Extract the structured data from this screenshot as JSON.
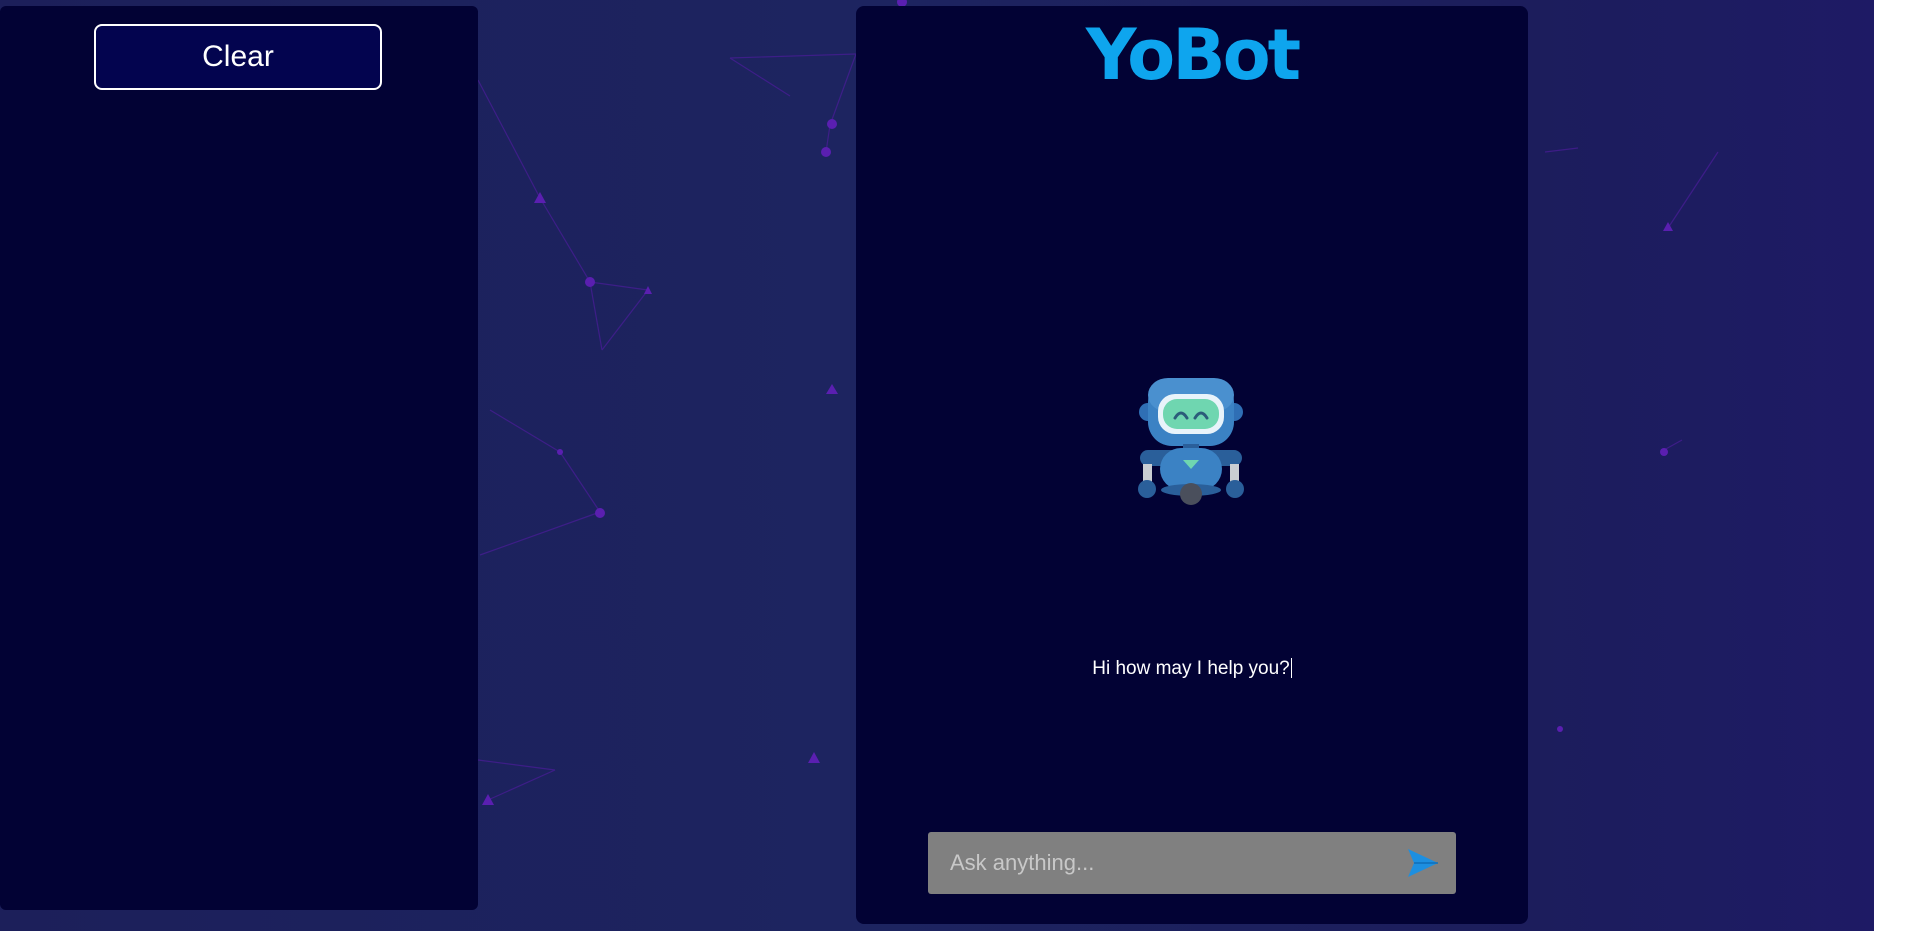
{
  "history_panel": {
    "clear_label": "Clear"
  },
  "chat": {
    "title": "YoBot",
    "greeting": "Hi how may I help you?",
    "input": {
      "value": "",
      "placeholder": "Ask anything..."
    }
  },
  "icons": {
    "avatar": "robot-icon",
    "send": "send-arrow-icon"
  },
  "colors": {
    "page_background": "#1d2460",
    "panel_background": "#020234",
    "title": "#0ea5ee",
    "clear_button": "#03044f",
    "input_background": "#808080",
    "send_icon": "#1d8fe0",
    "network_lines": "#5a1fb0"
  }
}
